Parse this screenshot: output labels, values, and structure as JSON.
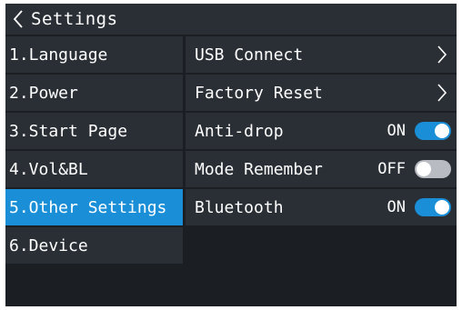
{
  "header": {
    "back_icon": "chevron-left-icon",
    "title": "Settings"
  },
  "menu": {
    "items": [
      {
        "label": "1.Language",
        "active": false
      },
      {
        "label": "2.Power",
        "active": false
      },
      {
        "label": "3.Start Page",
        "active": false
      },
      {
        "label": "4.Vol&BL",
        "active": false
      },
      {
        "label": "5.Other Settings",
        "active": true
      },
      {
        "label": "6.Device",
        "active": false
      }
    ]
  },
  "panel": {
    "rows": [
      {
        "label": "USB Connect",
        "type": "link",
        "icon": "chevron-right-icon"
      },
      {
        "label": "Factory Reset",
        "type": "link",
        "icon": "chevron-right-icon"
      },
      {
        "label": "Anti-drop",
        "type": "toggle",
        "state_text": "ON",
        "on": true
      },
      {
        "label": "Mode Remember",
        "type": "toggle",
        "state_text": "OFF",
        "on": false
      },
      {
        "label": "Bluetooth",
        "type": "toggle",
        "state_text": "ON",
        "on": true
      }
    ]
  },
  "colors": {
    "background": "#1b1f24",
    "tile": "#2a2f36",
    "accent": "#1a8fd8",
    "toggle_off": "#b8bcc2",
    "text": "#ffffff"
  }
}
